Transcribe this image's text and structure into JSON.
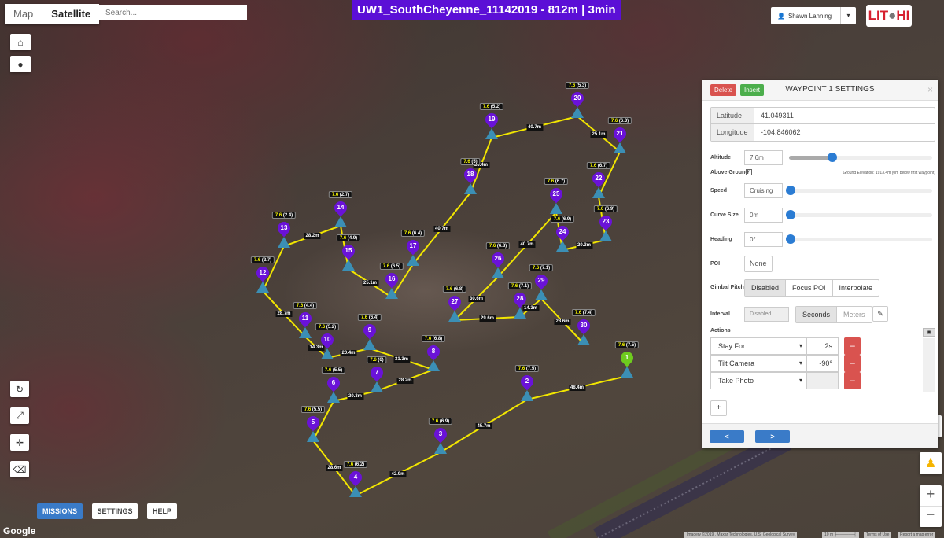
{
  "map_type": {
    "map": "Map",
    "satellite": "Satellite",
    "active": "Satellite"
  },
  "search": {
    "placeholder": "Search..."
  },
  "mission_title": "UW1_SouthCheyenne_11142019 - 812m | 3min",
  "user": {
    "name": "Shawn Lanning"
  },
  "logo_text": "LITCHI",
  "left_controls": [
    "home-icon",
    "globe-icon",
    "rotate-icon",
    "expand-icon",
    "move-icon",
    "eraser-icon"
  ],
  "bottom_nav": {
    "missions": "MISSIONS",
    "settings": "SETTINGS",
    "help": "HELP"
  },
  "google_label": "Google",
  "attribution": {
    "imagery": "Imagery ©2019 , Maxar Technologies, U.S. Geological Survey",
    "scale": "10 m",
    "terms": "Terms of Use",
    "report": "Report a map error"
  },
  "zoom": {
    "in": "+",
    "out": "−"
  },
  "waypoints": [
    {
      "n": "1",
      "alt": "7.6",
      "ground": "(7.5)",
      "color": "#6ecb1e"
    },
    {
      "n": "2",
      "alt": "7.6",
      "ground": "(7.5)"
    },
    {
      "n": "3",
      "alt": "7.6",
      "ground": "(6.9)"
    },
    {
      "n": "4",
      "alt": "7.6",
      "ground": "(6.2)"
    },
    {
      "n": "5",
      "alt": "7.6",
      "ground": "(5.5)"
    },
    {
      "n": "6",
      "alt": "7.6",
      "ground": "(5.5)"
    },
    {
      "n": "7",
      "alt": "7.6",
      "ground": "(6)"
    },
    {
      "n": "8",
      "alt": "7.6",
      "ground": "(6.8)"
    },
    {
      "n": "9",
      "alt": "7.6",
      "ground": "(6.4)"
    },
    {
      "n": "10",
      "alt": "7.6",
      "ground": "(5.2)"
    },
    {
      "n": "11",
      "alt": "7.6",
      "ground": "(4.4)"
    },
    {
      "n": "12",
      "alt": "7.6",
      "ground": "(2.7)"
    },
    {
      "n": "13",
      "alt": "7.6",
      "ground": "(2.4)"
    },
    {
      "n": "14",
      "alt": "7.6",
      "ground": "(2.7)"
    },
    {
      "n": "15",
      "alt": "7.6",
      "ground": "(4.9)"
    },
    {
      "n": "16",
      "alt": "7.6",
      "ground": "(6.5)"
    },
    {
      "n": "17",
      "alt": "7.6",
      "ground": "(6.4)"
    },
    {
      "n": "18",
      "alt": "7.6",
      "ground": "(5)"
    },
    {
      "n": "19",
      "alt": "7.6",
      "ground": "(5.2)"
    },
    {
      "n": "20",
      "alt": "7.6",
      "ground": "(5.3)"
    },
    {
      "n": "21",
      "alt": "7.6",
      "ground": "(6.3)"
    },
    {
      "n": "22",
      "alt": "7.6",
      "ground": "(6.7)"
    },
    {
      "n": "23",
      "alt": "7.6",
      "ground": "(6.9)"
    },
    {
      "n": "24",
      "alt": "7.6",
      "ground": "(6.9)"
    },
    {
      "n": "25",
      "alt": "7.6",
      "ground": "(6.7)"
    },
    {
      "n": "26",
      "alt": "7.6",
      "ground": "(6.8)"
    },
    {
      "n": "27",
      "alt": "7.6",
      "ground": "(6.8)"
    },
    {
      "n": "28",
      "alt": "7.6",
      "ground": "(7.1)"
    },
    {
      "n": "29",
      "alt": "7.6",
      "ground": "(7.1)"
    },
    {
      "n": "30",
      "alt": "7.6",
      "ground": "(7.4)"
    }
  ],
  "segment_distances": [
    "48.4m",
    "45.7m",
    "42.9m",
    "28.6m",
    null,
    "20.3m",
    "28.2m",
    "31.3m",
    "20.4m",
    "14.3m",
    "28.7m",
    null,
    "28.2m",
    null,
    "25.1m",
    null,
    "40.7m",
    "25.4m",
    "40.7m",
    "25.1m",
    null,
    null,
    "20.3m",
    null,
    "40.7m",
    "30.6m",
    "29.6m",
    "14.3m",
    "28.6m"
  ],
  "route_color": "#f2e600",
  "panel": {
    "delete": "Delete",
    "insert": "Insert",
    "title": "WAYPOINT 1 SETTINGS",
    "close": "×",
    "latitude_label": "Latitude",
    "latitude": "41.049311",
    "longitude_label": "Longitude",
    "longitude": "-104.846062",
    "altitude_label": "Altitude",
    "altitude": "7.6m",
    "altitude_slider": 0.3,
    "above_ground_label": "Above Ground",
    "above_ground": true,
    "ground_elevation": "Ground Elevation: 1913.4m (0m below first waypoint)",
    "speed_label": "Speed",
    "speed": "Cruising",
    "curve_label": "Curve Size",
    "curve": "0m",
    "heading_label": "Heading",
    "heading": "0°",
    "poi_label": "POI",
    "poi": "None",
    "gimbal_label": "Gimbal Pitch",
    "gimbal_options": [
      "Disabled",
      "Focus POI",
      "Interpolate"
    ],
    "interval_label": "Interval",
    "interval": "Disabled",
    "interval_units": [
      "Seconds",
      "Meters"
    ],
    "actions_label": "Actions",
    "actions": [
      {
        "type": "Stay For",
        "value": "2s"
      },
      {
        "type": "Tilt Camera",
        "value": "-90°"
      },
      {
        "type": "Take Photo",
        "value": ""
      }
    ],
    "add": "+",
    "prev": "<",
    "next": ">"
  }
}
